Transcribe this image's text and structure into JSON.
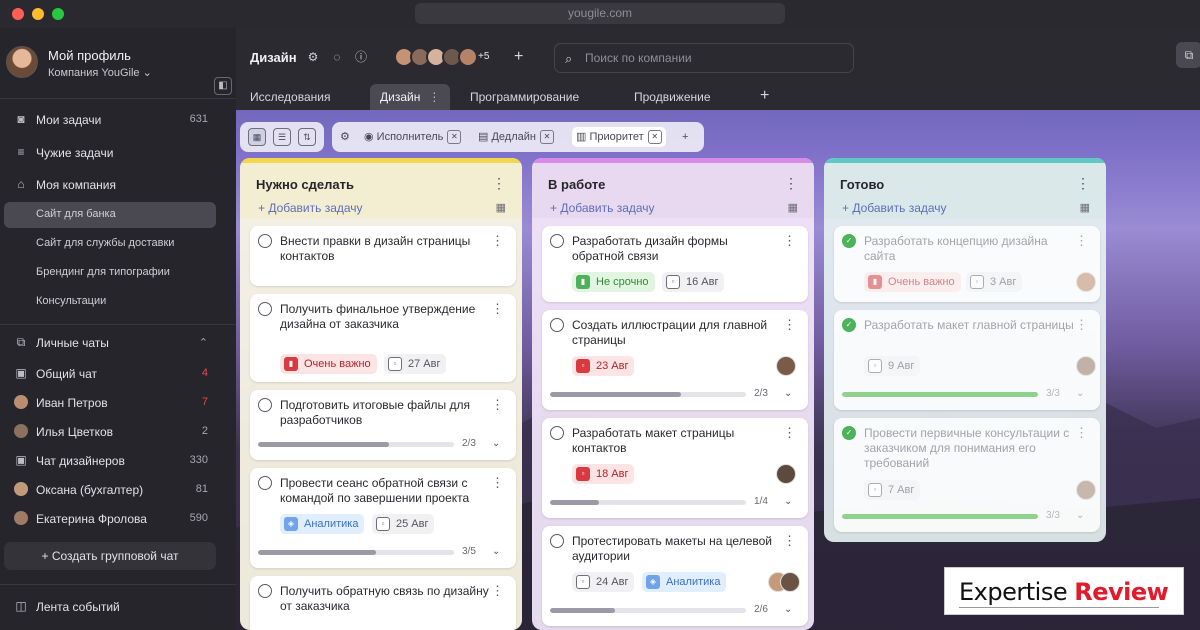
{
  "browser": {
    "url": "yougile.com"
  },
  "sidebar": {
    "profile_name": "Мой профиль",
    "company": "Компания YouGile ⌄",
    "items": [
      {
        "label": "Мои задачи",
        "count": "631"
      },
      {
        "label": "Чужие задачи",
        "count": ""
      },
      {
        "label": "Моя компания",
        "count": ""
      }
    ],
    "projects": [
      "Сайт для банка",
      "Сайт для службы доставки",
      "Брендинг для типографии",
      "Консультации"
    ],
    "chats_header": "Личные чаты",
    "chats": [
      {
        "label": "Общий чат",
        "count": "4"
      },
      {
        "label": "Иван Петров",
        "count": "7"
      },
      {
        "label": "Илья Цветков",
        "count": "2"
      },
      {
        "label": "Чат дизайнеров",
        "count": "330"
      },
      {
        "label": "Оксана (бухгалтер)",
        "count": "81"
      },
      {
        "label": "Екатерина Фролова",
        "count": "590"
      }
    ],
    "create_chat": "+  Создать групповой чат",
    "events": "Лента событий"
  },
  "header": {
    "project_title": "Дизайн",
    "members_more": "+5",
    "search_placeholder": "Поиск по компании",
    "tabs": [
      "Исследования",
      "Дизайн",
      "Программирование",
      "Продвижение"
    ],
    "tab_more": "⋮",
    "add_tab": "+"
  },
  "filters": {
    "assignee": "Исполнитель",
    "deadline": "Дедлайн",
    "priority": "Приоритет"
  },
  "board": {
    "add_task": "+ Добавить задачу",
    "columns": [
      {
        "title": "Нужно сделать",
        "cards": [
          {
            "title": "Внести правки в дизайн страницы контактов"
          },
          {
            "title": "Получить финальное утверждение дизайна от заказчика",
            "tag": "Очень важно",
            "date": "27 Авг"
          },
          {
            "title": "Подготовить итоговые файлы для разработчиков",
            "progress": "2/3",
            "fraction": 0.67
          },
          {
            "title": "Провести сеанс обратной связи с командой по завершении проекта",
            "tag": "Аналитика",
            "date": "25 Авг",
            "progress": "3/5",
            "fraction": 0.6
          },
          {
            "title": "Получить обратную связь по дизайну от заказчика"
          }
        ]
      },
      {
        "title": "В работе",
        "cards": [
          {
            "title": "Разработать дизайн формы обратной связи",
            "tag": "Не срочно",
            "date": "16 Авг"
          },
          {
            "title": "Создать иллюстрации для главной страницы",
            "date": "23 Авг",
            "progress": "2/3",
            "fraction": 0.67
          },
          {
            "title": "Разработать макет страницы контактов",
            "date": "18 Авг",
            "progress": "1/4",
            "fraction": 0.25
          },
          {
            "title": "Протестировать макеты на целевой аудитории",
            "date": "24 Авг",
            "tag": "Аналитика",
            "progress": "2/6",
            "fraction": 0.33
          }
        ]
      },
      {
        "title": "Готово",
        "cards": [
          {
            "title": "Разработать концепцию дизайна сайта",
            "tag": "Очень важно",
            "date": "3 Авг"
          },
          {
            "title": "Разработать макет главной страницы",
            "date": "9 Авг",
            "progress": "3/3",
            "fraction": 1.0
          },
          {
            "title": "Провести первичные консультации с заказчиком для понимания его требований",
            "date": "7 Авг",
            "progress": "3/3",
            "fraction": 1.0
          }
        ]
      }
    ]
  },
  "watermark": {
    "text_a": "Expertise",
    "text_b": "Review"
  },
  "colors": {
    "todo_stripe": "#f4d64e",
    "inprogress_stripe": "#d78ae6",
    "done_stripe": "#5ec9c4"
  }
}
